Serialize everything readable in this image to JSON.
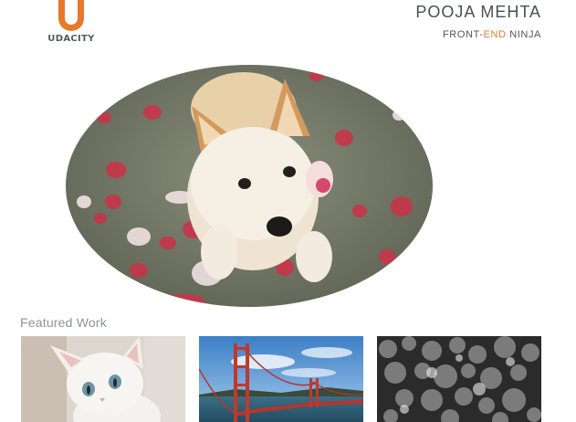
{
  "header": {
    "logo_text": "UDACITY",
    "name": "POOJA MEHTA",
    "tagline_pre": "FRONT-",
    "tagline_accent": "END",
    "tagline_post": " NINJA"
  },
  "hero": {
    "image": "puppy-with-rose-petals"
  },
  "featured": {
    "title": "Featured Work",
    "items": [
      {
        "image": "white-kitten"
      },
      {
        "image": "golden-gate-bridge"
      },
      {
        "image": "bokeh-lights"
      }
    ]
  },
  "colors": {
    "accent": "#e8782a",
    "text": "#4a4f55"
  }
}
